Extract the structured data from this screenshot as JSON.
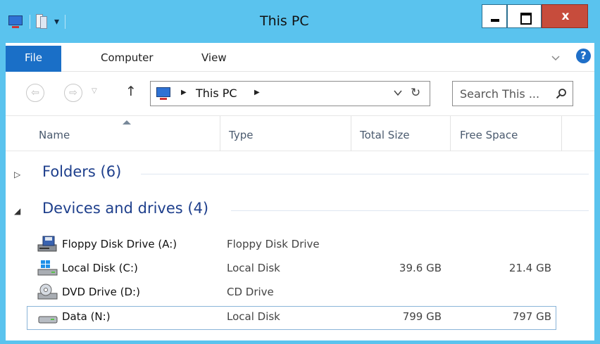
{
  "window": {
    "title": "This PC",
    "accent_color": "#5ac3ee",
    "close_label": "x"
  },
  "ribbon": {
    "tabs": [
      {
        "label": "File",
        "active": true
      },
      {
        "label": "Computer"
      },
      {
        "label": "View"
      }
    ],
    "help_label": "?"
  },
  "navigation": {
    "breadcrumb": [
      "This PC"
    ],
    "search_placeholder": "Search This ..."
  },
  "columns": [
    "Name",
    "Type",
    "Total Size",
    "Free Space"
  ],
  "groups": [
    {
      "label": "Folders (6)",
      "expanded": false
    },
    {
      "label": "Devices and drives (4)",
      "expanded": true
    }
  ],
  "drives": [
    {
      "icon": "floppy-drive-icon",
      "name": "Floppy Disk Drive (A:)",
      "type": "Floppy Disk Drive",
      "total": "",
      "free": ""
    },
    {
      "icon": "windows-disk-icon",
      "name": "Local Disk (C:)",
      "type": "Local Disk",
      "total": "39.6 GB",
      "free": "21.4 GB"
    },
    {
      "icon": "dvd-drive-icon",
      "name": "DVD Drive (D:)",
      "type": "CD Drive",
      "total": "",
      "free": ""
    },
    {
      "icon": "hard-disk-icon",
      "name": "Data (N:)",
      "type": "Local Disk",
      "total": "799 GB",
      "free": "797 GB",
      "selected": true
    }
  ]
}
